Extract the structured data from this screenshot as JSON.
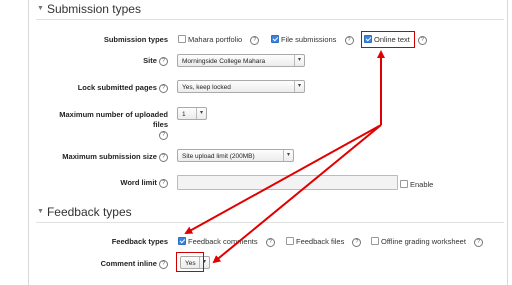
{
  "submission": {
    "header": "Submission types",
    "submission_types_label": "Submission types",
    "options": [
      {
        "label": "Mahara portfolio",
        "checked": false
      },
      {
        "label": "File submissions",
        "checked": true
      },
      {
        "label": "Online text",
        "checked": true
      }
    ],
    "site_label": "Site",
    "site_value": "Morningside College Mahara",
    "lock_label": "Lock submitted pages",
    "lock_value": "Yes, keep locked",
    "max_files_label_1": "Maximum number of uploaded",
    "max_files_label_2": "files",
    "max_files_value": "1",
    "max_size_label": "Maximum submission size",
    "max_size_value": "Site upload limit (200MB)",
    "word_limit_label": "Word limit",
    "word_limit_value": "",
    "enable_label": "Enable"
  },
  "feedback": {
    "header": "Feedback types",
    "feedback_types_label": "Feedback types",
    "options": [
      {
        "label": "Feedback comments",
        "checked": true
      },
      {
        "label": "Feedback files",
        "checked": false
      },
      {
        "label": "Offline grading worksheet",
        "checked": false
      }
    ],
    "comment_inline_label": "Comment inline",
    "comment_inline_value": "Yes"
  },
  "icons": {
    "help": "?",
    "dropdown": "▾",
    "collapse": "▼"
  },
  "colors": {
    "annotation_red": "#e00000",
    "checkbox_blue": "#3b84e0"
  }
}
